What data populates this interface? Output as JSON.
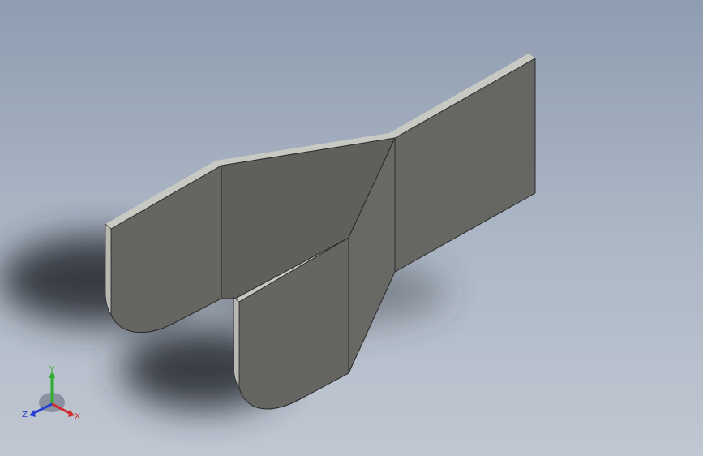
{
  "viewport": {
    "background_top": "#8f9db1",
    "background_bottom": "#c0c7d2"
  },
  "model": {
    "face_color": "#646461",
    "face_dark_color": "#5c5c5a",
    "edge_color": "#c9c9c4",
    "outline_color": "#2a2a2a"
  },
  "triad": {
    "y_label": "Y",
    "x_label": "X",
    "z_label": "Z",
    "y_color": "#2fae2f",
    "x_color": "#d02a2a",
    "z_color": "#2a3fd0"
  }
}
